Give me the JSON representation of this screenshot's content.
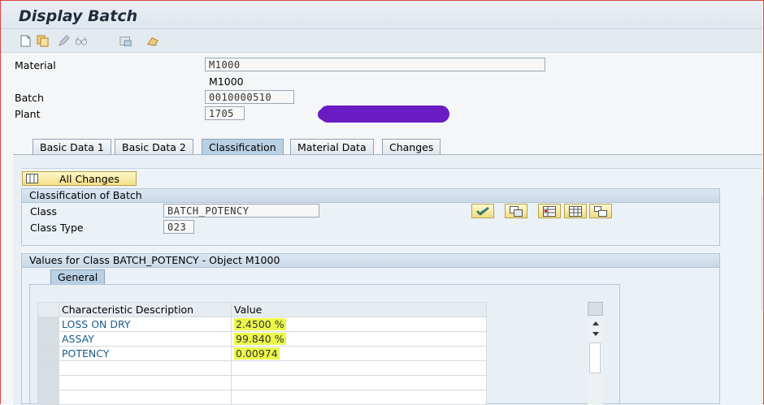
{
  "window": {
    "title": "Display Batch"
  },
  "toolbar": {
    "icons": [
      "new-document-icon",
      "copy-icon",
      "edit-pencil-icon",
      "glasses-display-icon",
      "save-variant-icon",
      "delete-icon"
    ]
  },
  "header": {
    "material_label": "Material",
    "material_value": "M1000",
    "material_desc": "M1000",
    "batch_label": "Batch",
    "batch_value": "0010000510",
    "plant_label": "Plant",
    "plant_value": "1705"
  },
  "tabs": [
    {
      "label": "Basic Data 1",
      "active": false
    },
    {
      "label": "Basic Data 2",
      "active": false
    },
    {
      "label": "Classification",
      "active": true
    },
    {
      "label": "Material Data",
      "active": false
    },
    {
      "label": "Changes",
      "active": false
    }
  ],
  "classification": {
    "all_changes_label": "All Changes",
    "section_title": "Classification of Batch",
    "class_label": "Class",
    "class_value": "BATCH_POTENCY",
    "class_type_label": "Class Type",
    "class_type_value": "023"
  },
  "values_section": {
    "title": "Values for Class BATCH_POTENCY - Object M1000",
    "subtab": "General",
    "columns": [
      "Characteristic Description",
      "Value"
    ],
    "rows": [
      {
        "desc": "LOSS ON DRY",
        "value": "2.4500 %"
      },
      {
        "desc": "ASSAY",
        "value": "99.840 %"
      },
      {
        "desc": "POTENCY",
        "value": "0.00974"
      },
      {
        "desc": "",
        "value": ""
      },
      {
        "desc": "",
        "value": ""
      },
      {
        "desc": "",
        "value": ""
      }
    ]
  },
  "colors": {
    "highlight": "#ecf84a",
    "redaction": "#6a1bc4",
    "link_blue": "#1a5a8c"
  }
}
